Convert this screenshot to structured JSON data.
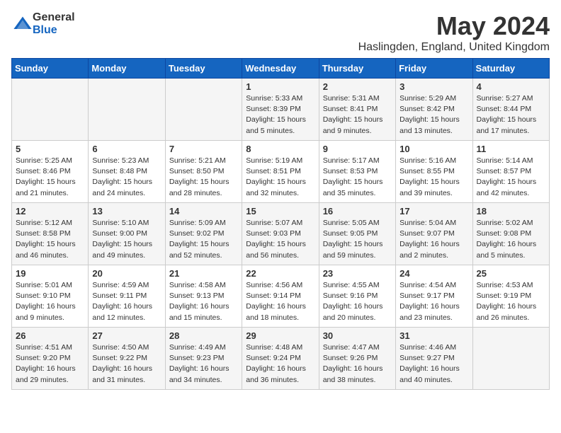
{
  "header": {
    "logo_general": "General",
    "logo_blue": "Blue",
    "month_title": "May 2024",
    "location": "Haslingden, England, United Kingdom"
  },
  "days_of_week": [
    "Sunday",
    "Monday",
    "Tuesday",
    "Wednesday",
    "Thursday",
    "Friday",
    "Saturday"
  ],
  "weeks": [
    [
      {
        "day": "",
        "detail": ""
      },
      {
        "day": "",
        "detail": ""
      },
      {
        "day": "",
        "detail": ""
      },
      {
        "day": "1",
        "detail": "Sunrise: 5:33 AM\nSunset: 8:39 PM\nDaylight: 15 hours\nand 5 minutes."
      },
      {
        "day": "2",
        "detail": "Sunrise: 5:31 AM\nSunset: 8:41 PM\nDaylight: 15 hours\nand 9 minutes."
      },
      {
        "day": "3",
        "detail": "Sunrise: 5:29 AM\nSunset: 8:42 PM\nDaylight: 15 hours\nand 13 minutes."
      },
      {
        "day": "4",
        "detail": "Sunrise: 5:27 AM\nSunset: 8:44 PM\nDaylight: 15 hours\nand 17 minutes."
      }
    ],
    [
      {
        "day": "5",
        "detail": "Sunrise: 5:25 AM\nSunset: 8:46 PM\nDaylight: 15 hours\nand 21 minutes."
      },
      {
        "day": "6",
        "detail": "Sunrise: 5:23 AM\nSunset: 8:48 PM\nDaylight: 15 hours\nand 24 minutes."
      },
      {
        "day": "7",
        "detail": "Sunrise: 5:21 AM\nSunset: 8:50 PM\nDaylight: 15 hours\nand 28 minutes."
      },
      {
        "day": "8",
        "detail": "Sunrise: 5:19 AM\nSunset: 8:51 PM\nDaylight: 15 hours\nand 32 minutes."
      },
      {
        "day": "9",
        "detail": "Sunrise: 5:17 AM\nSunset: 8:53 PM\nDaylight: 15 hours\nand 35 minutes."
      },
      {
        "day": "10",
        "detail": "Sunrise: 5:16 AM\nSunset: 8:55 PM\nDaylight: 15 hours\nand 39 minutes."
      },
      {
        "day": "11",
        "detail": "Sunrise: 5:14 AM\nSunset: 8:57 PM\nDaylight: 15 hours\nand 42 minutes."
      }
    ],
    [
      {
        "day": "12",
        "detail": "Sunrise: 5:12 AM\nSunset: 8:58 PM\nDaylight: 15 hours\nand 46 minutes."
      },
      {
        "day": "13",
        "detail": "Sunrise: 5:10 AM\nSunset: 9:00 PM\nDaylight: 15 hours\nand 49 minutes."
      },
      {
        "day": "14",
        "detail": "Sunrise: 5:09 AM\nSunset: 9:02 PM\nDaylight: 15 hours\nand 52 minutes."
      },
      {
        "day": "15",
        "detail": "Sunrise: 5:07 AM\nSunset: 9:03 PM\nDaylight: 15 hours\nand 56 minutes."
      },
      {
        "day": "16",
        "detail": "Sunrise: 5:05 AM\nSunset: 9:05 PM\nDaylight: 15 hours\nand 59 minutes."
      },
      {
        "day": "17",
        "detail": "Sunrise: 5:04 AM\nSunset: 9:07 PM\nDaylight: 16 hours\nand 2 minutes."
      },
      {
        "day": "18",
        "detail": "Sunrise: 5:02 AM\nSunset: 9:08 PM\nDaylight: 16 hours\nand 5 minutes."
      }
    ],
    [
      {
        "day": "19",
        "detail": "Sunrise: 5:01 AM\nSunset: 9:10 PM\nDaylight: 16 hours\nand 9 minutes."
      },
      {
        "day": "20",
        "detail": "Sunrise: 4:59 AM\nSunset: 9:11 PM\nDaylight: 16 hours\nand 12 minutes."
      },
      {
        "day": "21",
        "detail": "Sunrise: 4:58 AM\nSunset: 9:13 PM\nDaylight: 16 hours\nand 15 minutes."
      },
      {
        "day": "22",
        "detail": "Sunrise: 4:56 AM\nSunset: 9:14 PM\nDaylight: 16 hours\nand 18 minutes."
      },
      {
        "day": "23",
        "detail": "Sunrise: 4:55 AM\nSunset: 9:16 PM\nDaylight: 16 hours\nand 20 minutes."
      },
      {
        "day": "24",
        "detail": "Sunrise: 4:54 AM\nSunset: 9:17 PM\nDaylight: 16 hours\nand 23 minutes."
      },
      {
        "day": "25",
        "detail": "Sunrise: 4:53 AM\nSunset: 9:19 PM\nDaylight: 16 hours\nand 26 minutes."
      }
    ],
    [
      {
        "day": "26",
        "detail": "Sunrise: 4:51 AM\nSunset: 9:20 PM\nDaylight: 16 hours\nand 29 minutes."
      },
      {
        "day": "27",
        "detail": "Sunrise: 4:50 AM\nSunset: 9:22 PM\nDaylight: 16 hours\nand 31 minutes."
      },
      {
        "day": "28",
        "detail": "Sunrise: 4:49 AM\nSunset: 9:23 PM\nDaylight: 16 hours\nand 34 minutes."
      },
      {
        "day": "29",
        "detail": "Sunrise: 4:48 AM\nSunset: 9:24 PM\nDaylight: 16 hours\nand 36 minutes."
      },
      {
        "day": "30",
        "detail": "Sunrise: 4:47 AM\nSunset: 9:26 PM\nDaylight: 16 hours\nand 38 minutes."
      },
      {
        "day": "31",
        "detail": "Sunrise: 4:46 AM\nSunset: 9:27 PM\nDaylight: 16 hours\nand 40 minutes."
      },
      {
        "day": "",
        "detail": ""
      }
    ]
  ]
}
